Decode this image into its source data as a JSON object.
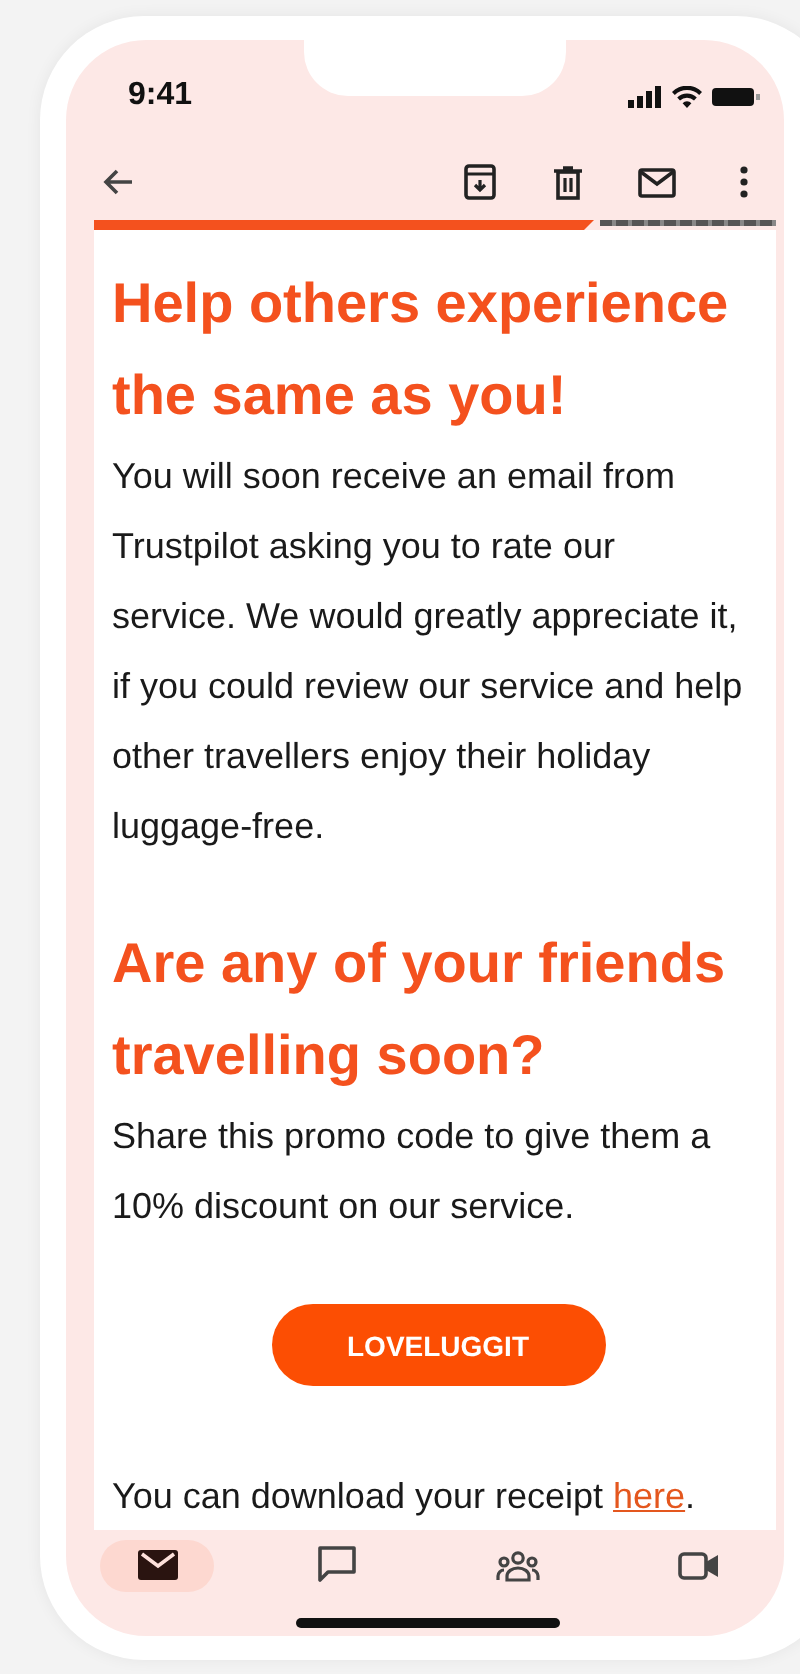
{
  "status_bar": {
    "time": "9:41"
  },
  "toolbar": {
    "actions": [
      {
        "kind": "archive"
      },
      {
        "kind": "delete"
      },
      {
        "kind": "mail"
      },
      {
        "kind": "more"
      }
    ]
  },
  "email": {
    "sections": [
      {
        "heading": "Help others experience the same as you!",
        "body": "You will soon receive an email from Trustpilot asking you to rate our service. We would greatly appreciate it, if you could review our service and help other travellers enjoy their holiday luggage-free."
      },
      {
        "heading": "Are any of your friends travelling soon?",
        "body": "Share this promo code to give them a 10% discount on our service."
      }
    ],
    "promo_code": "LOVELUGGIT",
    "receipt_text": "You can download your receipt",
    "receipt_link": "here",
    "receipt_end": "."
  },
  "bottom_nav": [
    {
      "kind": "mail",
      "selected": true
    },
    {
      "kind": "chat",
      "selected": false
    },
    {
      "kind": "people",
      "selected": false
    },
    {
      "kind": "video",
      "selected": false
    }
  ]
}
